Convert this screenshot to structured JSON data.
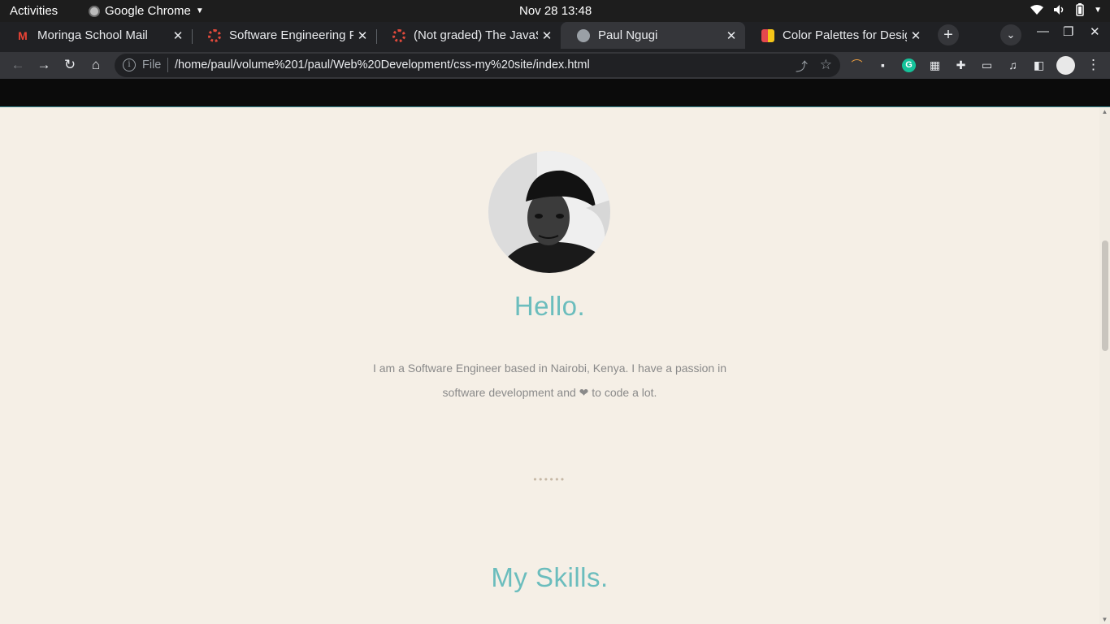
{
  "system_bar": {
    "activities": "Activities",
    "app_name": "Google Chrome",
    "clock": "Nov 28  13:48"
  },
  "tabs": [
    {
      "title": "Moringa School Mail",
      "icon": "gmail-icon",
      "active": false
    },
    {
      "title": "Software Engineering F",
      "icon": "loading-ring-icon",
      "active": false
    },
    {
      "title": "(Not graded) The JavaSc",
      "icon": "loading-ring-icon",
      "active": false
    },
    {
      "title": "Paul Ngugi",
      "icon": "site-favicon",
      "active": true
    },
    {
      "title": "Color Palettes for Desig",
      "icon": "palette-favicon",
      "active": false
    }
  ],
  "toolbar": {
    "scheme": "File",
    "url": "/home/paul/volume%201/paul/Web%20Development/css-my%20site/index.html"
  },
  "page": {
    "greeting": "Hello.",
    "intro_line1": "I am a Software Engineer based in Nairobi, Kenya. I have a passion in",
    "intro_line2": "software development and ❤ to code a lot.",
    "divider": "••••••",
    "skills_heading": "My Skills."
  },
  "colors": {
    "page_background": "#f5efe6",
    "accent_teal": "#6bbdbd",
    "body_text": "#8a8a8a",
    "nav_background": "#0b0b0b"
  }
}
